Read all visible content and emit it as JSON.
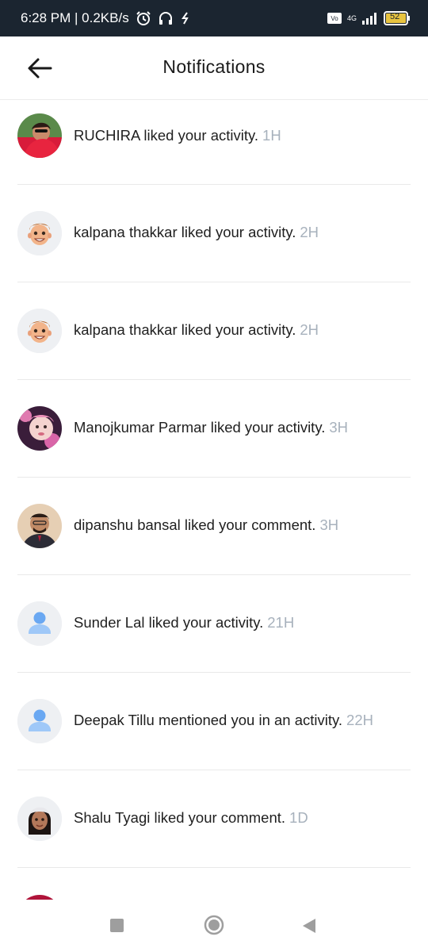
{
  "status_bar": {
    "time_speed": "6:28 PM | 0.2KB/s",
    "network": "4G",
    "battery": "52"
  },
  "header": {
    "title": "Notifications"
  },
  "notifications": [
    {
      "name": "RUCHIRA",
      "action": "liked your activity.",
      "time": "1H",
      "avatar": "photo-red"
    },
    {
      "name": "kalpana thakkar",
      "action": "liked your activity.",
      "time": "2H",
      "avatar": "memoji-boy"
    },
    {
      "name": "kalpana thakkar",
      "action": "liked your activity.",
      "time": "2H",
      "avatar": "memoji-boy"
    },
    {
      "name": "Manojkumar Parmar",
      "action": "liked your activity.",
      "time": "3H",
      "avatar": "photo-baby"
    },
    {
      "name": "dipanshu bansal",
      "action": "liked your comment.",
      "time": "3H",
      "avatar": "photo-man"
    },
    {
      "name": "Sunder Lal",
      "action": "liked your activity.",
      "time": "21H",
      "avatar": "default-user"
    },
    {
      "name": "Deepak Tillu",
      "action": "mentioned you in an activity.",
      "time": "22H",
      "avatar": "default-user"
    },
    {
      "name": "Shalu Tyagi",
      "action": "liked your comment.",
      "time": "1D",
      "avatar": "memoji-girl"
    }
  ],
  "colors": {
    "status_bar_bg": "#1b2530",
    "timestamp": "#a7b1bc",
    "default_avatar_blue": "#6aa8f2"
  }
}
